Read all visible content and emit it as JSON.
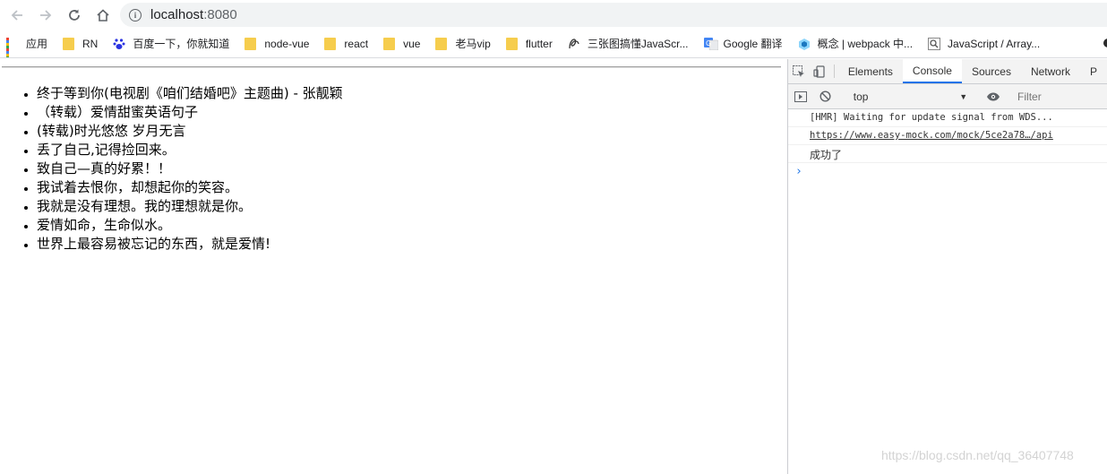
{
  "browser": {
    "url_host": "localhost",
    "url_port": ":8080"
  },
  "bookmarks": [
    {
      "label": "应用",
      "icon": "apps-grid-icon"
    },
    {
      "label": "RN",
      "icon": "folder-icon"
    },
    {
      "label": "百度一下，你就知道",
      "icon": "baidu-paw-icon"
    },
    {
      "label": "node-vue",
      "icon": "folder-icon"
    },
    {
      "label": "react",
      "icon": "folder-icon"
    },
    {
      "label": "vue",
      "icon": "folder-icon"
    },
    {
      "label": "老马vip",
      "icon": "folder-icon"
    },
    {
      "label": "flutter",
      "icon": "folder-icon"
    },
    {
      "label": "三张图搞懂JavaScr...",
      "icon": "site-logo-icon"
    },
    {
      "label": "Google 翻译",
      "icon": "google-translate-icon"
    },
    {
      "label": "概念 | webpack 中...",
      "icon": "webpack-cube-icon"
    },
    {
      "label": "JavaScript / Array...",
      "icon": "search-page-icon"
    }
  ],
  "page": {
    "items": [
      "终于等到你(电视剧《咱们结婚吧》主题曲) - 张靓颖",
      "（转载）爱情甜蜜英语句子",
      "(转载)时光悠悠 岁月无言",
      "丢了自己,记得捡回来。",
      "致自己—真的好累！！",
      "我试着去恨你，却想起你的笑容。",
      "我就是没有理想。我的理想就是你。",
      "爱情如命，生命似水。",
      "世界上最容易被忘记的东西，就是爱情!"
    ]
  },
  "devtools": {
    "tabs": [
      "Elements",
      "Console",
      "Sources",
      "Network",
      "P"
    ],
    "active_tab": "Console",
    "context": "top",
    "filter_placeholder": "Filter",
    "messages": [
      "[HMR] Waiting for update signal from WDS...",
      "https://www.easy-mock.com/mock/5ce2a78…/api",
      "成功了"
    ],
    "prompt_symbol": "›"
  },
  "watermark": "https://blog.csdn.net/qq_36407748",
  "colors": {
    "accent": "#1a73e8",
    "folder": "#f6cd4d"
  }
}
